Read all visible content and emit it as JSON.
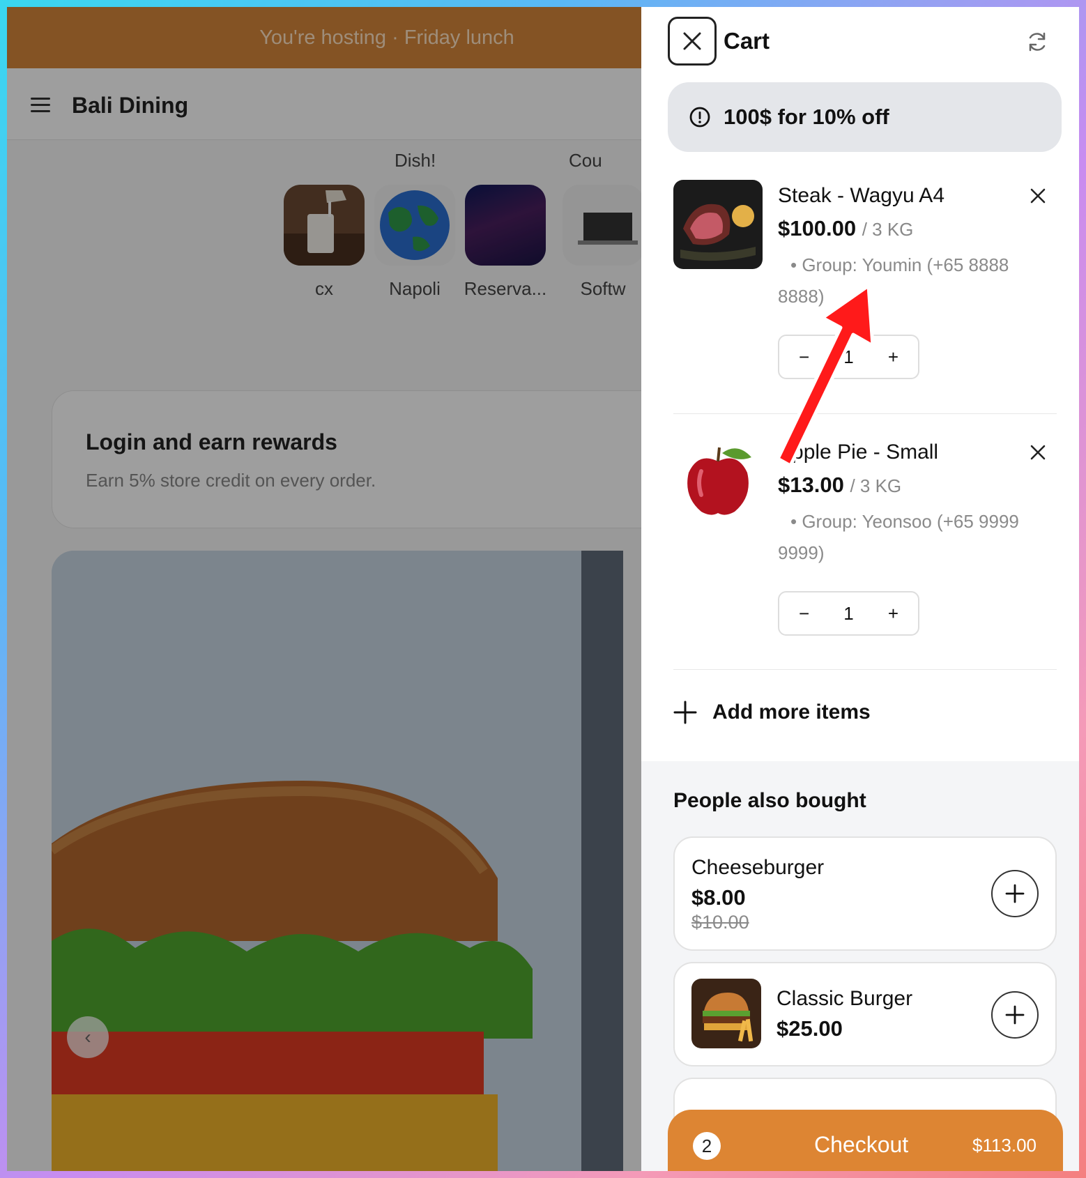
{
  "background_app": {
    "banner": "You're hosting · Friday lunch",
    "brand": "Bali Dining",
    "category_partial_labels": [
      "Dish!",
      "Cou"
    ],
    "categories": [
      {
        "name": "cx",
        "icon": "milk-image"
      },
      {
        "name": "Napoli",
        "icon": "globe-image"
      },
      {
        "name": "Reserva...",
        "icon": "gradient-image"
      },
      {
        "name": "Softw",
        "icon": "laptop-image"
      }
    ],
    "login_card": {
      "title": "Login and earn rewards",
      "subtitle": "Earn 5% store credit on every order."
    },
    "carousel_prev": "‹"
  },
  "cart": {
    "title": "Cart",
    "promo": "100$ for 10% off",
    "items": [
      {
        "name": "Steak - Wagyu A4",
        "price": "$100.00",
        "unit": "/ 3 KG",
        "group": "• Group: Youmin (+65 8888 8888)",
        "quantity": "1",
        "image": "steak-image"
      },
      {
        "name": "Apple Pie - Small",
        "price": "$13.00",
        "unit": "/ 3 KG",
        "group": "• Group: Yeonsoo (+65 9999 9999)",
        "quantity": "1",
        "image": "apple-image"
      }
    ],
    "stepper_minus": "−",
    "stepper_plus": "+",
    "add_more": "Add more items",
    "also_bought": {
      "title": "People also bought",
      "items": [
        {
          "name": "Cheeseburger",
          "price": "$8.00",
          "old_price": "$10.00"
        },
        {
          "name": "Classic Burger",
          "price": "$25.00",
          "image": "burger-image"
        }
      ]
    },
    "checkout": {
      "count": "2",
      "label": "Checkout",
      "total": "$113.00"
    }
  },
  "colors": {
    "accent": "#dd8533",
    "annotation_arrow": "#ff1a1a"
  }
}
